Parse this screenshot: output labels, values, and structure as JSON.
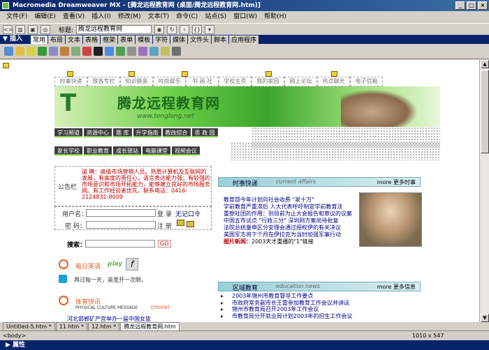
{
  "window": {
    "title": "Macromedia Dreamweaver MX - [腾龙远程教育网 (桌面/腾龙远程教育网.htm)]",
    "controls": [
      "_",
      "□",
      "×"
    ]
  },
  "menu": [
    "文件(F)",
    "编辑(E)",
    "查看(V)",
    "插入(I)",
    "修改(M)",
    "文本(T)",
    "命令(C)",
    "站点(S)",
    "窗口(W)",
    "帮助(H)"
  ],
  "document_toolbar": {
    "title_label": "标题:",
    "title_value": "腾龙远程教育网"
  },
  "insert_bar": {
    "label": "▼ 插入",
    "tabs": [
      "常用",
      "布局",
      "文本",
      "表格",
      "框架",
      "表单",
      "模板",
      "字符",
      "媒体",
      "文件头",
      "脚本",
      "应用程序"
    ],
    "active_tab": "常用"
  },
  "page": {
    "top_nav": [
      "时事快递",
      "致各专栏",
      "知识撷英",
      "时尚娱乐",
      "书 画 社",
      "学校主页",
      "我的家园",
      "网上论坛",
      "热点聊天",
      "电子信箱"
    ],
    "banner": {
      "logo": "腾龙远程教育网",
      "url": "www.tenglong.net"
    },
    "nav_row1": [
      "学习频道",
      "资源中心",
      "题 库",
      "升学指南",
      "教改综合",
      "思 政 园"
    ],
    "nav_row2": [
      "家长学校",
      "职业教育",
      "成长驿站",
      "电脑课堂",
      "视频会议"
    ],
    "notice": {
      "label": "公告栏",
      "text": "诚 聘：高级市场营销人员。熟悉计算机及互联网的发展，有高度的责任心，语言表达能力强；有较强的市场意识和市场开拓能力，能够建立良好的市场服务网。有工作经验者优先。联系电话：0416-2124831-8009"
    },
    "login": {
      "user_label": "用户名：",
      "password_label": "密 码：",
      "login_label": "登 录",
      "register_label": "注 册",
      "enroll_label": "无记口令"
    },
    "search": {
      "label": "搜索：",
      "button": "GO"
    },
    "daily_english": {
      "title": "每日英语",
      "badge": "play",
      "text": "再过每一天，英里开一次眼。"
    },
    "sports": {
      "title": "体育快讯",
      "subtitle": "PHYSICAL CULTURE MESSAGE",
      "more": "(more)",
      "item": "河北邯郸矿产宫举办一届中国女篮"
    },
    "current_affairs": {
      "title": "时事快递",
      "subtitle": "current affairs",
      "more": "more 更多时事",
      "items": [
        "教育部今年计划向社会收费 \"家十万\"",
        "学前教育严重滞后 人大代表呼吁制定学前教育法",
        "重塑社团的作用：到目前为止大会报告和审议的议案",
        "中国五市试点 \"行政三分\" 深圳刚方案尚待批复",
        "法院总统量申区分安理会通过授权伊的有关决议",
        "美国军方将下个月在伊拉克为当时加强军事行动",
        "2003天才重播的\"1\"链接"
      ],
      "hl_prefix": "图片新闻："
    },
    "district": {
      "title": "区域教育",
      "subtitle": "education news",
      "more": "more 更多信息",
      "items": [
        "2003年锦州市教育督导工作要点",
        "市政府常务副市长王雷参加教育工作会议并讲话",
        "锦州市教育局召开2003年工作会议",
        "市教育局分开就业局计划2003年的招生工作会议"
      ]
    }
  },
  "doc_tabs": [
    "Untitled-5.htm *",
    "11.htm *",
    "12.htm *",
    "腾龙远程教育网.htm"
  ],
  "status": {
    "tag": "<body>",
    "size": "1010 x 547"
  },
  "properties_panel": {
    "title": "▶ 属性"
  }
}
